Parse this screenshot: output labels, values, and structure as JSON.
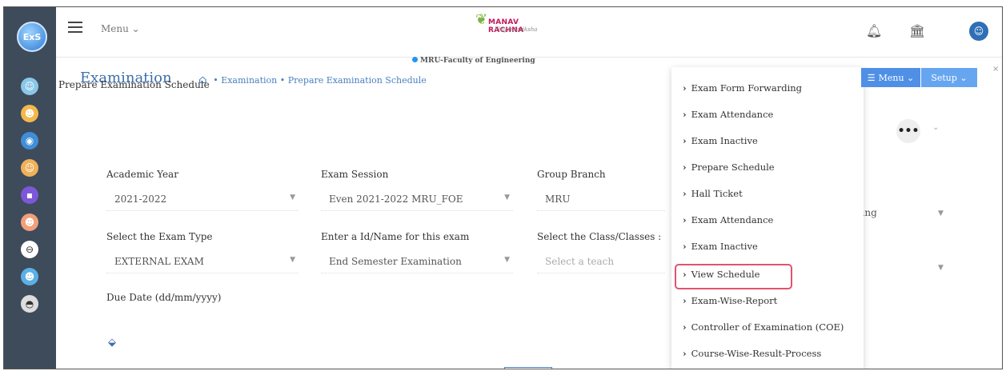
{
  "topbar": {
    "menu_label": "Menu ⌄",
    "brand_line1": "MANAV RACHNA",
    "brand_line2": "Vidyantariksha",
    "faculty": "MRU-Faculty of Engineering"
  },
  "rail": {
    "logo_text": "ExS"
  },
  "page": {
    "title": "Examination",
    "breadcrumb": [
      "Examination",
      "Prepare Examination Schedule"
    ],
    "card_title": "Prepare Examination Schedule"
  },
  "form": {
    "academic_year_label": "Academic Year",
    "academic_year_value": "2021-2022",
    "exam_session_label": "Exam Session",
    "exam_session_value": "Even 2021-2022 MRU_FOE",
    "group_branch_label": "Group Branch",
    "group_branch_value": "MRU",
    "exam_type_label": "Select the Exam Type",
    "exam_type_value": "EXTERNAL EXAM",
    "exam_name_label": "Enter a Id/Name for this exam",
    "exam_name_value": "End Semester Examination",
    "class_label": "Select the Class/Classes :",
    "class_placeholder": "Select a teach",
    "due_date_label": "Due Date (dd/mm/yyyy)",
    "partial_value": "ineering"
  },
  "actions": {
    "menu_label": "Menu ⌄",
    "setup_label": "Setup ⌄",
    "more_label": "•••"
  },
  "dropdown": {
    "items": [
      "Exam Form Forwarding",
      "Exam Attendance",
      "Exam Inactive",
      "Prepare Schedule",
      "Hall Ticket",
      "Exam Attendance",
      "Exam Inactive",
      "View Schedule",
      "Exam-Wise-Report",
      "Controller of Examination (COE)",
      "Course-Wise-Result-Process"
    ],
    "highlighted": "View Schedule"
  },
  "colors": {
    "accent": "#3d6fa8",
    "highlight": "#e0546f",
    "button": "#4f90e6",
    "rail": "#3e4b5b"
  }
}
